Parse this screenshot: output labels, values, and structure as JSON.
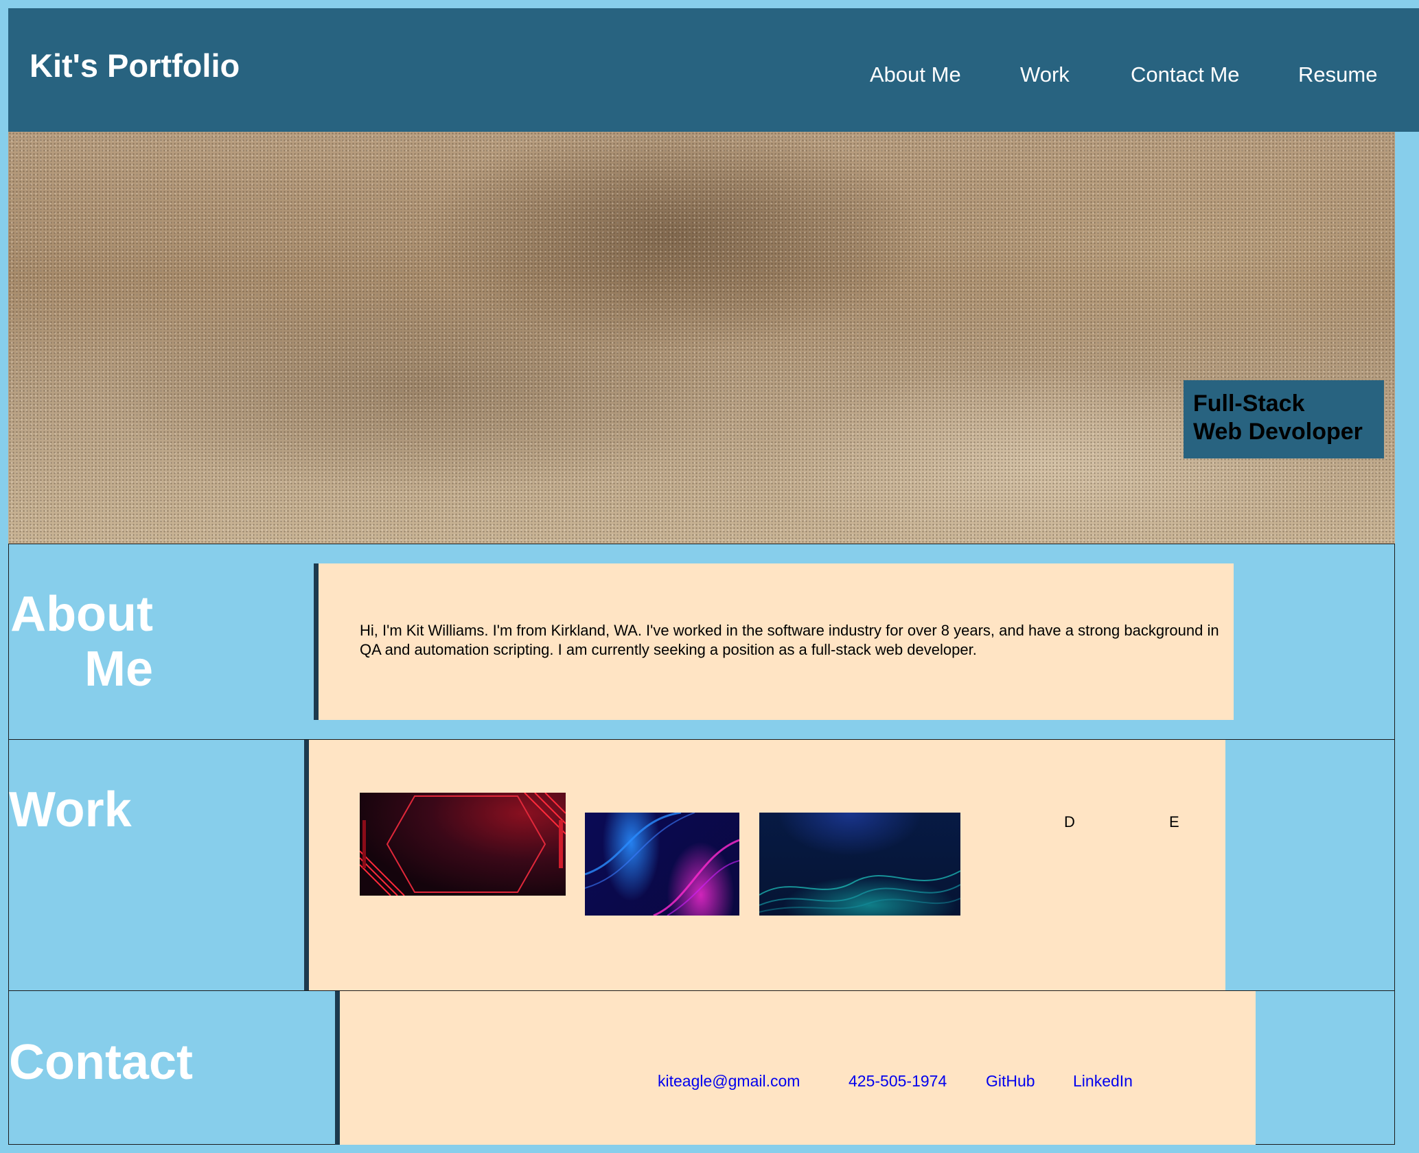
{
  "header": {
    "logo": "Kit's Portfolio",
    "nav": [
      "About Me",
      "Work",
      "Contact Me",
      "Resume"
    ]
  },
  "hero": {
    "badge_line1": "Full-Stack",
    "badge_line2": "Web Devoloper"
  },
  "about": {
    "title_line1": "About",
    "title_line2": "Me",
    "text": "Hi, I'm Kit Williams. I'm from Kirkland, WA. I've worked in the software industry for over 8 years, and have a strong background in QA and automation scripting. I am currently seeking a position as a full-stack web developer."
  },
  "work": {
    "title": "Work",
    "items": [
      "D",
      "E"
    ]
  },
  "contact": {
    "title": "Contact",
    "links": [
      "kiteagle@gmail.com",
      "425-505-1974",
      "GitHub",
      "LinkedIn"
    ]
  },
  "colors": {
    "page_background": "#87ceeb",
    "header_background": "#286380",
    "panel_background": "#ffe4c4",
    "link": "#0000ee"
  }
}
